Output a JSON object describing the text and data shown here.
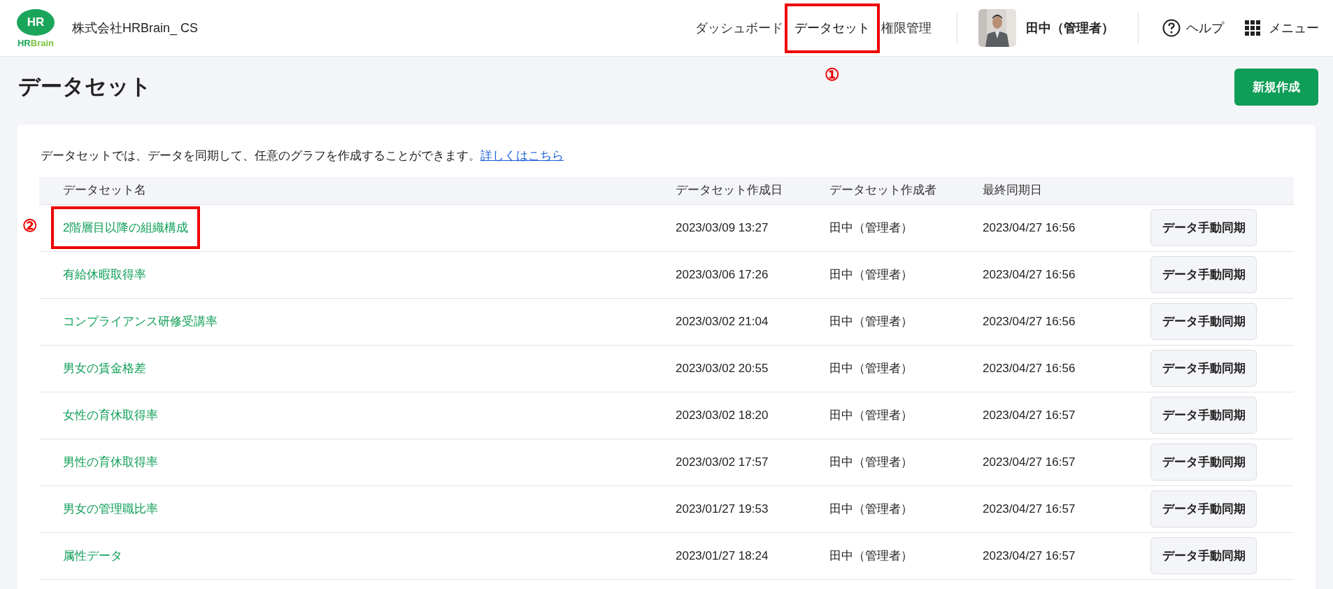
{
  "header": {
    "logo": {
      "mark": "HR",
      "wordmark_1": "HR",
      "wordmark_2": "Brain"
    },
    "company": "株式会社HRBrain_ CS",
    "nav": [
      {
        "label": "ダッシュボード",
        "selected": false,
        "annotated": false
      },
      {
        "label": "データセット",
        "selected": true,
        "annotated": true,
        "annotation": "①"
      },
      {
        "label": "権限管理",
        "selected": false,
        "annotated": false
      }
    ],
    "user": {
      "name": "田中（管理者）"
    },
    "help": "ヘルプ",
    "menu": "メニュー"
  },
  "page": {
    "title": "データセット",
    "new_button": "新規作成"
  },
  "intro": {
    "text": "データセットでは、データを同期して、任意のグラフを作成することができます。",
    "link": "詳しくはこちら"
  },
  "table": {
    "columns": [
      "データセット名",
      "データセット作成日",
      "データセット作成者",
      "最終同期日"
    ],
    "rows": [
      {
        "name": "2階層目以降の組織構成",
        "created": "2023/03/09 13:27",
        "creator": "田中（管理者）",
        "synced": "2023/04/27 16:56",
        "button": "データ手動同期",
        "annotated": true,
        "annotation": "②"
      },
      {
        "name": "有給休暇取得率",
        "created": "2023/03/06 17:26",
        "creator": "田中（管理者）",
        "synced": "2023/04/27 16:56",
        "button": "データ手動同期",
        "annotated": false
      },
      {
        "name": "コンプライアンス研修受講率",
        "created": "2023/03/02 21:04",
        "creator": "田中（管理者）",
        "synced": "2023/04/27 16:56",
        "button": "データ手動同期",
        "annotated": false
      },
      {
        "name": "男女の賃金格差",
        "created": "2023/03/02 20:55",
        "creator": "田中（管理者）",
        "synced": "2023/04/27 16:56",
        "button": "データ手動同期",
        "annotated": false
      },
      {
        "name": "女性の育休取得率",
        "created": "2023/03/02 18:20",
        "creator": "田中（管理者）",
        "synced": "2023/04/27 16:57",
        "button": "データ手動同期",
        "annotated": false
      },
      {
        "name": "男性の育休取得率",
        "created": "2023/03/02 17:57",
        "creator": "田中（管理者）",
        "synced": "2023/04/27 16:57",
        "button": "データ手動同期",
        "annotated": false
      },
      {
        "name": "男女の管理職比率",
        "created": "2023/01/27 19:53",
        "creator": "田中（管理者）",
        "synced": "2023/04/27 16:57",
        "button": "データ手動同期",
        "annotated": false
      },
      {
        "name": "属性データ",
        "created": "2023/01/27 18:24",
        "creator": "田中（管理者）",
        "synced": "2023/04/27 16:57",
        "button": "データ手動同期",
        "annotated": false
      }
    ]
  }
}
